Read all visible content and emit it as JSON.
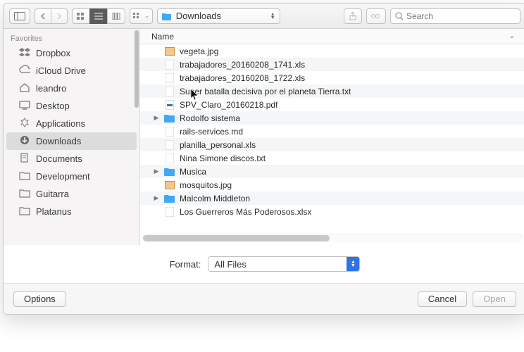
{
  "toolbar": {
    "path_label": "Downloads",
    "search_placeholder": "Search"
  },
  "sidebar": {
    "heading": "Favorites",
    "items": [
      {
        "icon": "dropbox",
        "label": "Dropbox"
      },
      {
        "icon": "cloud",
        "label": "iCloud Drive"
      },
      {
        "icon": "home",
        "label": "leandro"
      },
      {
        "icon": "desktop",
        "label": "Desktop"
      },
      {
        "icon": "apps",
        "label": "Applications"
      },
      {
        "icon": "download",
        "label": "Downloads",
        "selected": true
      },
      {
        "icon": "documents",
        "label": "Documents"
      },
      {
        "icon": "folder",
        "label": "Development"
      },
      {
        "icon": "folder",
        "label": "Guitarra"
      },
      {
        "icon": "folder",
        "label": "Platanus"
      }
    ]
  },
  "column_header": "Name",
  "files": [
    {
      "icon": "img",
      "name": "vegeta.jpg"
    },
    {
      "icon": "doc",
      "name": "trabajadores_20160208_1741.xls"
    },
    {
      "icon": "doc",
      "name": "trabajadores_20160208_1722.xls"
    },
    {
      "icon": "doc",
      "name": "Super batalla decisiva por el planeta Tierra.txt"
    },
    {
      "icon": "pdf",
      "name": "SPV_Claro_20160218.pdf"
    },
    {
      "icon": "folder",
      "name": "Rodolfo sistema",
      "expandable": true
    },
    {
      "icon": "doc",
      "name": "rails-services.md"
    },
    {
      "icon": "doc",
      "name": "planilla_personal.xls"
    },
    {
      "icon": "doc",
      "name": "Nina Simone discos.txt"
    },
    {
      "icon": "folder",
      "name": "Musica",
      "expandable": true
    },
    {
      "icon": "img",
      "name": "mosquitos.jpg"
    },
    {
      "icon": "folder",
      "name": "Malcolm Middleton",
      "expandable": true
    },
    {
      "icon": "doc",
      "name": "Los Guerreros Más Poderosos.xlsx"
    }
  ],
  "format": {
    "label": "Format:",
    "value": "All Files"
  },
  "footer": {
    "options": "Options",
    "cancel": "Cancel",
    "open": "Open"
  },
  "colors": {
    "folder": "#3fa9f5",
    "accent": "#2f72e4"
  }
}
